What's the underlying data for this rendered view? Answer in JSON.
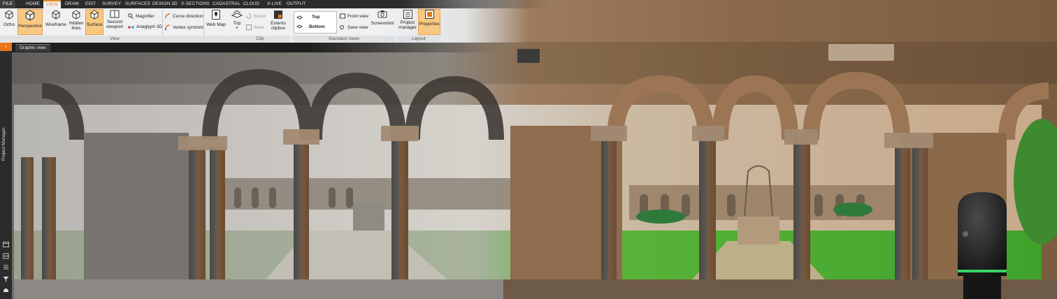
{
  "menu_tabs": [
    "FILE",
    "HOME",
    "VIEW",
    "DRAW",
    "EDIT",
    "SURVEY",
    "SURFACES",
    "DESIGN 3D",
    "X-SECTIONS",
    "CADASTRAL",
    "CLOUD",
    "X-LIVE",
    "OUTPUT"
  ],
  "active_tab": "VIEW",
  "ribbon": {
    "ortho": "Ortho",
    "perspective": "Perspective",
    "wireframe": "Wireframe",
    "hidden_lines": "Hidden lines",
    "surface": "Surface",
    "second_viewport": "Second viewport",
    "magnifier": "Magnifier",
    "anaglyph": "Anaglyph 3D",
    "curve_direction": "Curve direction",
    "vertex_symbols": "Vertex symbols",
    "web_map": "Web Map",
    "top": "Top",
    "reset": "Reset",
    "save": "Save",
    "extents_clipbox": "Extents clipbox",
    "view_top": "Top",
    "view_bottom": "Bottom",
    "front_view": "Front view",
    "save_view": "Save view",
    "screenshot": "Screenshot",
    "project_manager": "Project manager",
    "properties": "Properties",
    "group_view": "View",
    "group_clip": "Clip",
    "group_standard_views": "Standard views",
    "group_layout": "Layout"
  },
  "sidebar": {
    "label": "Project Manager",
    "toggle": "›"
  },
  "graphic_view_tab": "Graphic view",
  "colors": {
    "accent": "#e08a1b",
    "highlight": "#f7c882",
    "scanner_ring": "#39d26a"
  }
}
